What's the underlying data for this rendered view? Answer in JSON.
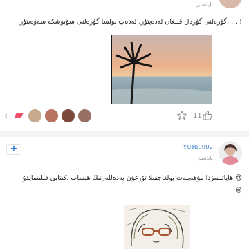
{
  "post1": {
    "time": "بايانسى",
    "text": "گۈزەلنى گۈزەل قىلغان ئەدەپتۇر، ئەدەپ بولسا گۈزەلنى سۆيۈشكە سەۋەبتۇر. . . !",
    "like_count": "11",
    "colors": {
      "sky": "#e9b48f",
      "sea": "#8fa6b0"
    }
  },
  "post2": {
    "username": "YURi0902",
    "time": "بايانسى",
    "text_line1": "ھاياتىمىزدا مۇھەببەت  بولغاچقىلا  تۇرغۇن بەدەللەرنىڭ ھېساب  .كىتابى قىلىنمايدۇ 😢",
    "text_line2": "😢"
  },
  "icons": {
    "add": "plus-icon",
    "star": "star-icon",
    "like": "thumbs-up-icon",
    "back": "chevron-left-icon"
  }
}
